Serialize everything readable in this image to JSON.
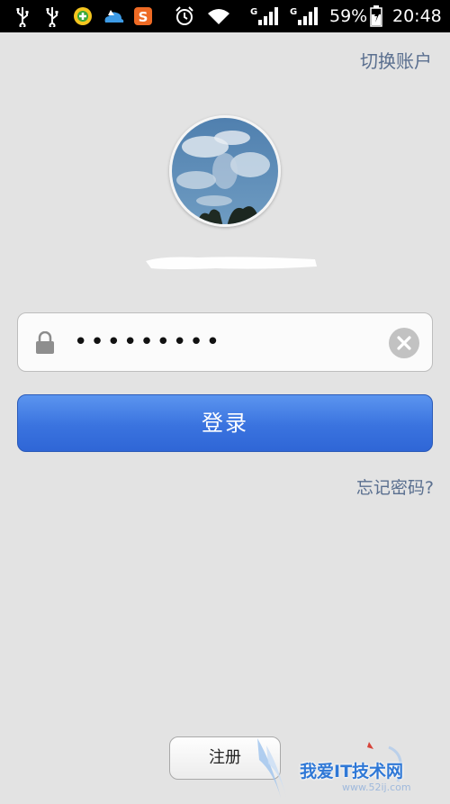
{
  "status_bar": {
    "battery_percent": "59%",
    "time": "20:48",
    "network_badge": "G",
    "icons": [
      "usb-icon",
      "usb-icon",
      "app-icon",
      "weather-icon",
      "sogou-icon",
      "alarm-icon",
      "wifi-icon",
      "signal-icon",
      "signal-icon",
      "battery-icon"
    ]
  },
  "header": {
    "switch_account": "切换账户"
  },
  "login": {
    "password_mask": "•••••••••",
    "login_label": "登录",
    "forgot_password": "忘记密码?",
    "register_label": "注册"
  },
  "watermark": {
    "text": "我爱IT技术网",
    "url": "www.52ij.com"
  },
  "colors": {
    "background": "#e3e3e3",
    "link": "#5a6f8f",
    "primary": "#3a73df"
  }
}
